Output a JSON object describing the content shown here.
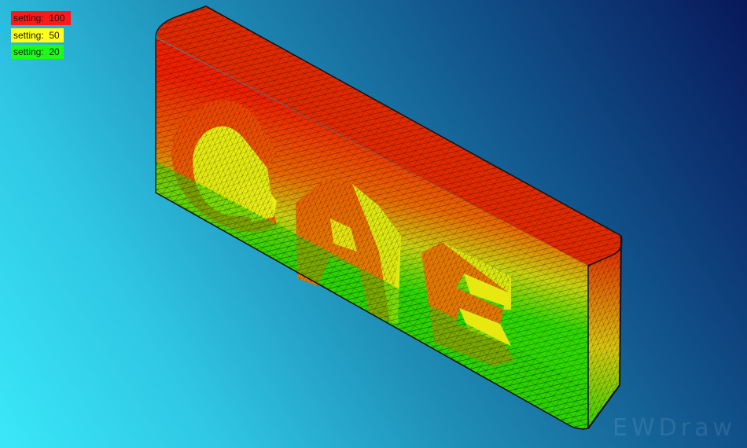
{
  "legend": {
    "entries": [
      {
        "label": "setting:  100",
        "color": "#ff1a1a"
      },
      {
        "label": "setting:  50",
        "color": "#ffff1a"
      },
      {
        "label": "setting:  20",
        "color": "#1aff1a"
      }
    ]
  },
  "watermark": "EWDraw",
  "colors": {
    "mesh_high": "#ee2200",
    "mesh_mid": "#ddee11",
    "mesh_low": "#22dd00",
    "background_light": "#3ae8f8",
    "background_dark": "#08185a"
  }
}
